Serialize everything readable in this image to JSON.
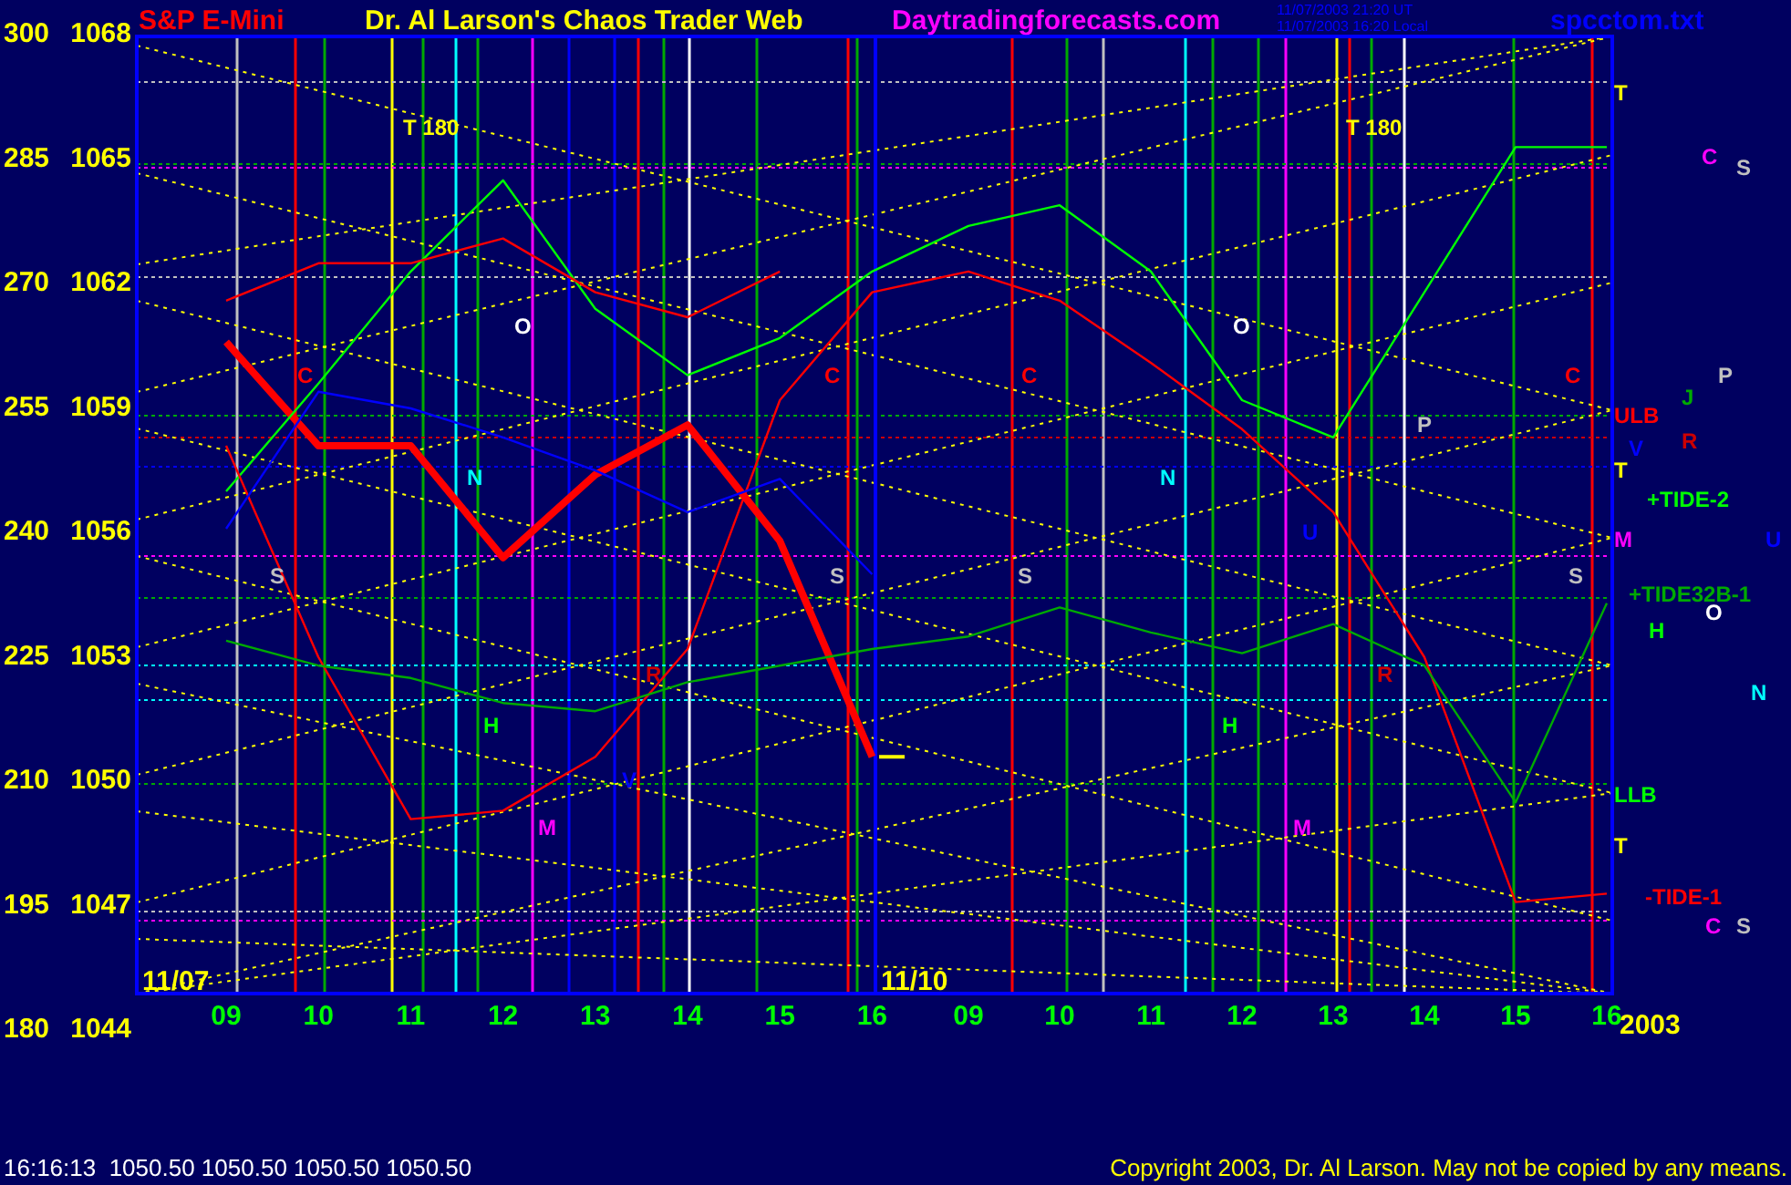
{
  "header": {
    "title": "Dr. Al Larson's Chaos Trader Web",
    "site": "Daytradingforecasts.com",
    "timestamps": [
      "11/07/2003 21:20 UT",
      "11/07/2003 16:20 Local"
    ],
    "file": "spcctom.txt"
  },
  "chart": {
    "chart_data": {
      "type": "line",
      "categories": [
        "09",
        "10",
        "11",
        "12",
        "13",
        "14",
        "15",
        "16",
        "09",
        "10",
        "11",
        "12",
        "13",
        "14",
        "15",
        "16"
      ],
      "ylim": [
        1044,
        1068
      ],
      "yticks": [
        1068,
        1065,
        1062,
        1059,
        1056,
        1053,
        1050,
        1047,
        1044
      ],
      "series": [
        {
          "name": "S&P E-Mini",
          "color": "#ff0000",
          "values": [
            1060.5,
            1058,
            1058,
            1055.3,
            1057.3,
            1058.5,
            1055.7,
            1050.5,
            null,
            null,
            null,
            null,
            null,
            null,
            null,
            null
          ]
        },
        {
          "color": "#00ff00",
          "values": [
            1056.9,
            1059.5,
            1062.2,
            1064.4,
            1061.3,
            1059.7,
            1060.6,
            1062.2,
            1063.3,
            1063.8,
            1062.2,
            1059.1,
            1058.2,
            1061.7,
            1065.2,
            1065.2
          ]
        },
        {
          "color": "#ff0000",
          "values": [
            1058.0,
            1052.9,
            1049.0,
            1049.2,
            1050.5,
            1053.1,
            1059.1,
            1061.7,
            1062.2,
            1061.5,
            1060.0,
            1058.4,
            1056.4,
            1052.9,
            1047.0,
            1047.2
          ]
        },
        {
          "color": "#ff0000",
          "values": [
            1061.5,
            1062.4,
            1062.4,
            1063.0,
            1061.7,
            1061.1,
            1062.2,
            null,
            null,
            null,
            null,
            null,
            null,
            null,
            null,
            null
          ]
        },
        {
          "color": "#00aa00",
          "values": [
            1053.3,
            1052.7,
            1052.4,
            1051.8,
            1051.6,
            1052.3,
            1052.7,
            1053.1,
            1053.4,
            1054.1,
            1053.5,
            1053.0,
            1053.7,
            1052.7,
            1049.4,
            1054.2
          ]
        },
        {
          "color": "#0000ff",
          "values": [
            1056.0,
            1059.3,
            1058.9,
            1058.2,
            1057.4,
            1056.4,
            1057.2,
            1054.9,
            null,
            null,
            null,
            null,
            null,
            null,
            null,
            null
          ]
        }
      ]
    },
    "secondary_axis": [
      "300",
      "285",
      "270",
      "255",
      "240",
      "225",
      "210",
      "195",
      "180"
    ],
    "date_labels": [
      "11/07",
      "11/10"
    ],
    "year": "2003",
    "markers": [
      {
        "text": "T",
        "color": "#ffff00"
      },
      {
        "text": "T 180",
        "color": "#ffff00"
      },
      {
        "text": "T 180",
        "color": "#ffff00"
      },
      {
        "text": "C",
        "color": "#ff00ff"
      },
      {
        "text": "S",
        "color": "#c0c0c0"
      },
      {
        "text": "O",
        "color": "#ffffff"
      },
      {
        "text": "O",
        "color": "#ffffff"
      },
      {
        "text": "C",
        "color": "#ff0000"
      },
      {
        "text": "C",
        "color": "#ff0000"
      },
      {
        "text": "C",
        "color": "#ff0000"
      },
      {
        "text": "C",
        "color": "#ff0000"
      },
      {
        "text": "P",
        "color": "#c0c0c0"
      },
      {
        "text": "J",
        "color": "#00aa00"
      },
      {
        "text": "ULB",
        "color": "#ff0000"
      },
      {
        "text": "P",
        "color": "#c0c0c0"
      },
      {
        "text": "R",
        "color": "#cc0000"
      },
      {
        "text": "V",
        "color": "#0000ff"
      },
      {
        "text": "T",
        "color": "#ffff00"
      },
      {
        "text": "N",
        "color": "#00ffff"
      },
      {
        "text": "N",
        "color": "#00ffff"
      },
      {
        "text": "+TIDE-2",
        "color": "#00ff00"
      },
      {
        "text": "U",
        "color": "#0000ff"
      },
      {
        "text": "M",
        "color": "#ff00ff"
      },
      {
        "text": "U",
        "color": "#0000ff"
      },
      {
        "text": "S",
        "color": "#c0c0c0"
      },
      {
        "text": "S",
        "color": "#c0c0c0"
      },
      {
        "text": "S",
        "color": "#c0c0c0"
      },
      {
        "text": "S",
        "color": "#c0c0c0"
      },
      {
        "text": "+TIDE32B-1",
        "color": "#00aa00"
      },
      {
        "text": "O",
        "color": "#ffffff"
      },
      {
        "text": "H",
        "color": "#00ff00"
      },
      {
        "text": "R",
        "color": "#cc0000"
      },
      {
        "text": "R",
        "color": "#cc0000"
      },
      {
        "text": "N",
        "color": "#00ffff"
      },
      {
        "text": "H",
        "color": "#00ff00"
      },
      {
        "text": "H",
        "color": "#00ff00"
      },
      {
        "text": "V",
        "color": "#0000ff"
      },
      {
        "text": "LLB",
        "color": "#00ff00"
      },
      {
        "text": "M",
        "color": "#ff00ff"
      },
      {
        "text": "M",
        "color": "#ff00ff"
      },
      {
        "text": "T",
        "color": "#ffff00"
      },
      {
        "text": "-TIDE-1",
        "color": "#ff0000"
      },
      {
        "text": "C",
        "color": "#ff00ff"
      },
      {
        "text": "S",
        "color": "#c0c0c0"
      }
    ]
  },
  "status_bar": {
    "quote": "16:16:13  1050.50 1050.50 1050.50 1050.50",
    "copyright": "Copyright 2003, Dr. Al Larson. May not be copied by any means."
  }
}
